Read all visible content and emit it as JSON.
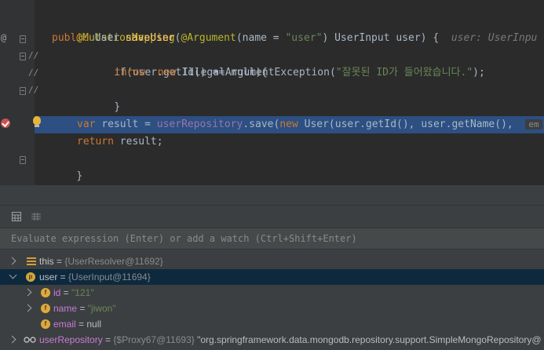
{
  "editor": {
    "lines": {
      "annotation": "@MutationMapping",
      "sig_public": "public",
      "sig_type": "User",
      "sig_method": "saveUser",
      "sig_paren": "(",
      "sig_arg_ann": "@Argument",
      "sig_name_eq": "(name = ",
      "sig_str": "\"user\"",
      "sig_rest": ") UserInput user) {",
      "sig_hint": "user: UserInpu",
      "if_line": "if(user.getId() == null){",
      "throw_kw": "throw",
      "new_kw": "new",
      "throw_rest": "IllegalArgumentException(",
      "throw_str": "\"잘못된 ID가 들어왔습니다.\"",
      "throw_end": ");",
      "close_brace": "}",
      "var_kw": "var",
      "var_mid": "result = ",
      "var_field": "userRepository",
      "var_save": ".save(",
      "var_new": "new",
      "var_tail": "User(user.getId(), user.getName(),",
      "var_hint": "em",
      "return_kw": "return",
      "return_rest": "result;",
      "method_close": "}",
      "class_close": "}"
    },
    "gutter": {
      "comment_marker_1": "//",
      "comment_marker_2": "//",
      "comment_marker_3": "//",
      "annotation_marker": "@"
    }
  },
  "debugger": {
    "eval_placeholder": "Evaluate expression (Enter) or add a watch (Ctrl+Shift+Enter)",
    "variables": [
      {
        "name": "this",
        "eq": " = ",
        "value": "{UserResolver@11692}"
      },
      {
        "name": "user",
        "eq": " = ",
        "value": "{UserInput@11694}"
      },
      {
        "name": "id",
        "eq": " = ",
        "value": "\"121\""
      },
      {
        "name": "name",
        "eq": " = ",
        "value": "\"jiwon\""
      },
      {
        "name": "email",
        "eq": " = ",
        "value": "null"
      },
      {
        "name": "userRepository",
        "eq": " = ",
        "value": "{$Proxy67@11693}",
        "extra": " \"org.springframework.data.mongodb.repository.support.SimpleMongoRepository@"
      }
    ]
  },
  "colors": {
    "editor_bg": "#2b2b2b",
    "highlight_line": "#2d4f82",
    "selected_row": "#0d293e",
    "breakpoint": "#c75450"
  }
}
